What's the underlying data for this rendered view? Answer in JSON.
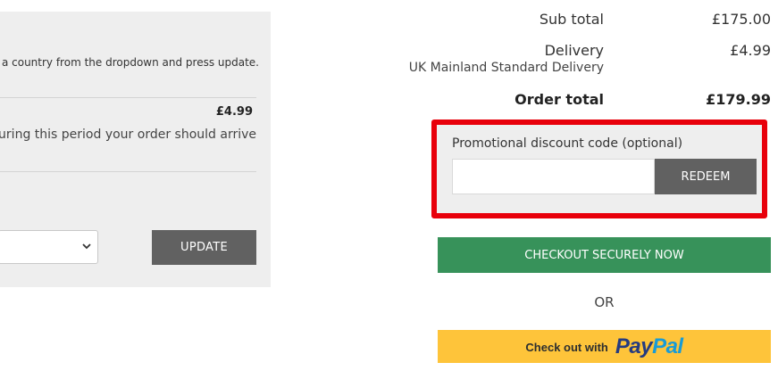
{
  "delivery_panel": {
    "instruction": "Please select a country from the dropdown and press update.",
    "option_price": "£4.99",
    "option_description": "During this period your order should arrive",
    "update_label": "UPDATE"
  },
  "totals": {
    "subtotal_label": "Sub total",
    "subtotal_value": "£175.00",
    "delivery_label": "Delivery",
    "delivery_value": "£4.99",
    "delivery_method": "UK Mainland Standard Delivery",
    "order_total_label": "Order total",
    "order_total_value": "£179.99"
  },
  "promo": {
    "label": "Promotional discount code (optional)",
    "input_value": "",
    "redeem_label": "REDEEM"
  },
  "checkout": {
    "checkout_label": "CHECKOUT SECURELY NOW",
    "or_label": "OR",
    "paypal_prefix": "Check out with",
    "paypal_logo_pay": "Pay",
    "paypal_logo_pal": "Pal"
  },
  "colors": {
    "panel_bg": "#eeeeee",
    "button_grey": "#616161",
    "checkout_green": "#37925a",
    "paypal_yellow": "#fec43a",
    "highlight_red": "#e8000b"
  },
  "icons": {
    "select_chevron": "chevron-down-icon"
  }
}
